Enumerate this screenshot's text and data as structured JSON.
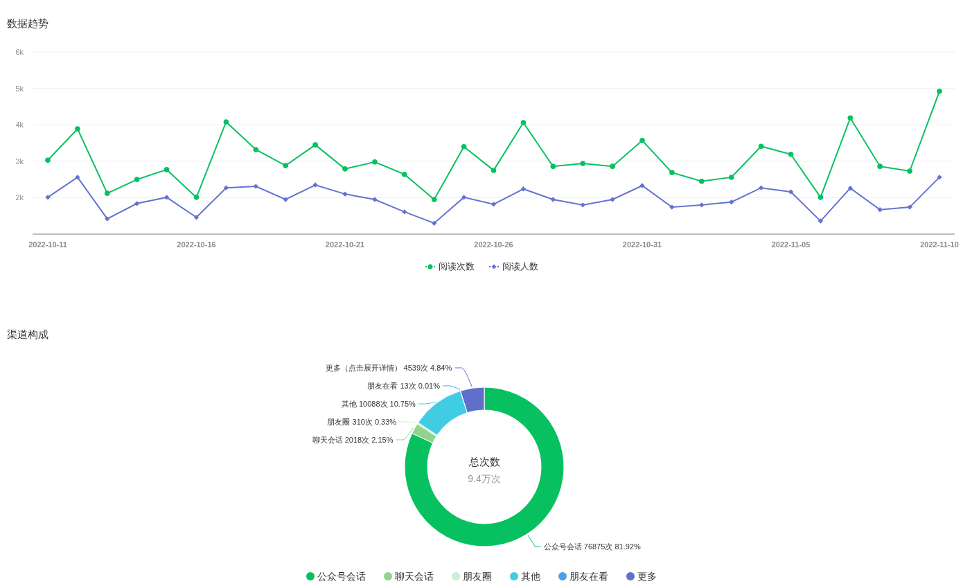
{
  "trend": {
    "title": "数据趋势",
    "chart_data": {
      "type": "line",
      "categories": [
        "2022-10-11",
        null,
        null,
        null,
        null,
        "2022-10-16",
        null,
        null,
        null,
        null,
        "2022-10-21",
        null,
        null,
        null,
        null,
        "2022-10-26",
        null,
        null,
        null,
        null,
        "2022-10-31",
        null,
        null,
        null,
        null,
        "2022-11-05",
        null,
        null,
        null,
        null,
        "2022-11-10"
      ],
      "grid": true,
      "series": [
        {
          "name": "阅读次数",
          "color": "#07c160",
          "marker": "circle",
          "values": [
            3030,
            3890,
            2120,
            2500,
            2770,
            2010,
            4080,
            3320,
            2880,
            3450,
            2790,
            2980,
            2640,
            1950,
            3400,
            2750,
            4060,
            2860,
            2940,
            2860,
            3570,
            2690,
            2450,
            2560,
            3410,
            3190,
            2010,
            4190,
            2860,
            2730,
            4920
          ]
        },
        {
          "name": "阅读人数",
          "color": "#6473d0",
          "marker": "diamond",
          "values": [
            2010,
            2560,
            1420,
            1840,
            2010,
            1460,
            2270,
            2310,
            1950,
            2350,
            2100,
            1950,
            1610,
            1300,
            2010,
            1820,
            2240,
            1950,
            1800,
            1950,
            2330,
            1740,
            1800,
            1880,
            2270,
            2160,
            1360,
            2260,
            1670,
            1740,
            2560
          ]
        }
      ],
      "ylim": [
        1000,
        6000
      ],
      "yticks": [
        {
          "value": 2000,
          "label": "2k"
        },
        {
          "value": 3000,
          "label": "3k"
        },
        {
          "value": 4000,
          "label": "4k"
        },
        {
          "value": 5000,
          "label": "5k"
        },
        {
          "value": 6000,
          "label": "6k"
        }
      ]
    }
  },
  "channels": {
    "title": "渠道构成",
    "center_title": "总次数",
    "center_value": "9.4万次",
    "chart_data": {
      "type": "donut",
      "categories": [
        "公众号会话",
        "聊天会话",
        "朋友圈",
        "其他",
        "朋友在看",
        "更多"
      ],
      "values": [
        76875,
        2018,
        310,
        10088,
        13,
        4539
      ],
      "colors": [
        "#07c160",
        "#8fd58b",
        "#cdeed3",
        "#40cde3",
        "#4aa1ea",
        "#5e70cc"
      ],
      "value_labels": [
        "公众号会话 76875次 81.92%",
        "聊天会话 2018次 2.15%",
        "朋友圈 310次 0.33%",
        "其他 10088次 10.75%",
        "朋友在看 13次 0.01%",
        "更多（点击展开详情） 4539次 4.84%"
      ]
    }
  }
}
